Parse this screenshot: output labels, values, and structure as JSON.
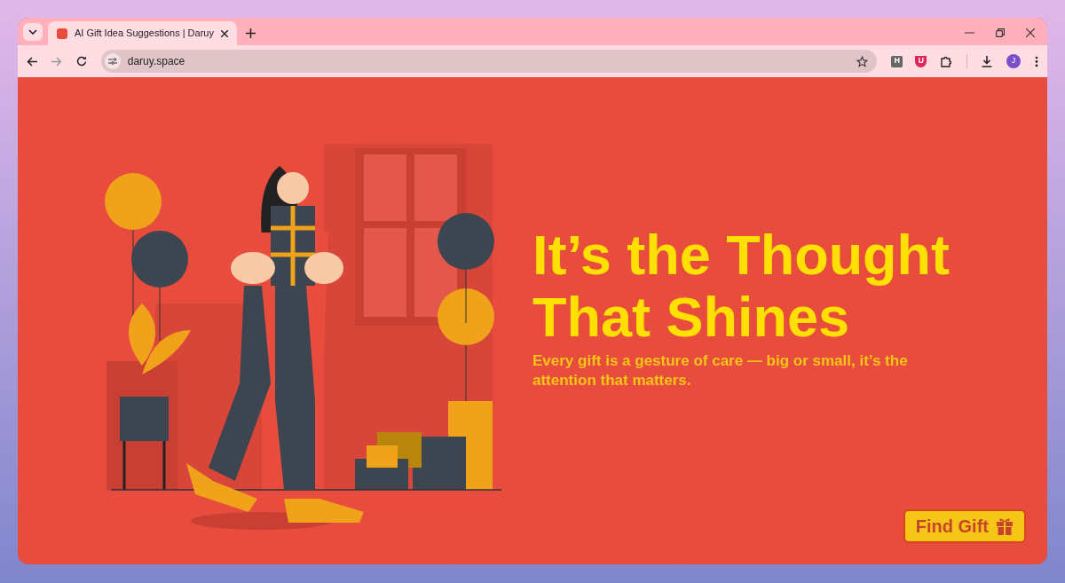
{
  "browser": {
    "tabs": [
      {
        "title": "AI Gift Idea Suggestions | Daruy",
        "selected": true
      }
    ],
    "url": "daruy.space",
    "extensions": [
      {
        "label": "H"
      },
      {
        "label": "U"
      }
    ],
    "profile": "J"
  },
  "hero": {
    "heading_lines": [
      "It’s the Thought",
      "That Shines"
    ],
    "subtitle": "Every gift is a gesture of care — big or small, it’s the attention that matters."
  },
  "cta": {
    "label": "Find Gift"
  }
}
